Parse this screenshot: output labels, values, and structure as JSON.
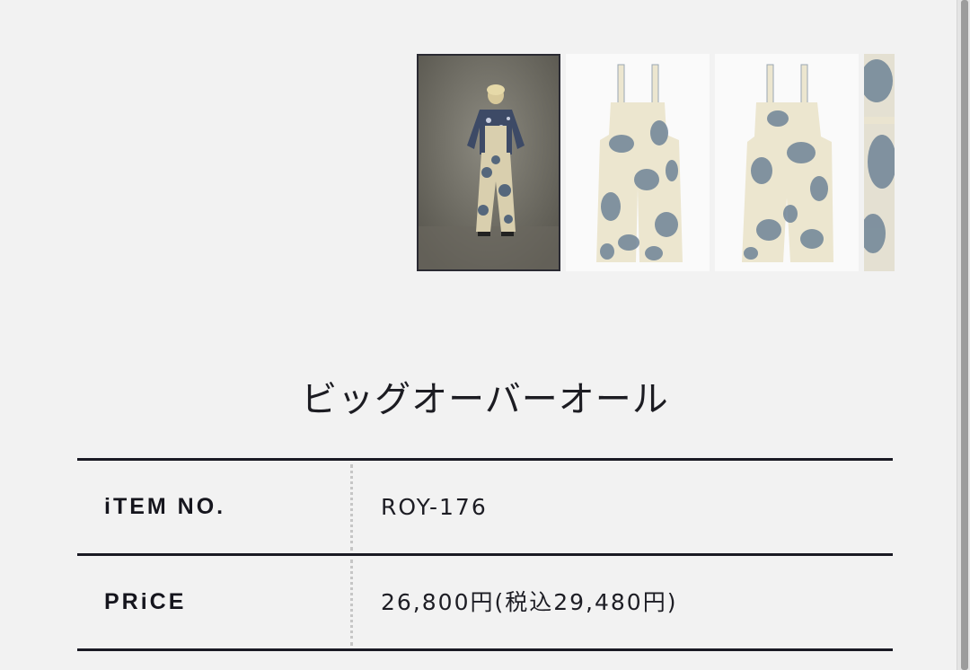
{
  "gallery": {
    "thumbnails": [
      {
        "kind": "model-photo",
        "selected": true
      },
      {
        "kind": "front-view",
        "selected": false
      },
      {
        "kind": "back-view",
        "selected": false
      },
      {
        "kind": "detail-view",
        "selected": false
      }
    ]
  },
  "product": {
    "title": "ビッグオーバーオール"
  },
  "specs": {
    "item_no_label": "iTEM NO.",
    "item_no_value": "ROY-176",
    "price_label": "PRiCE",
    "price_value": "26,800円(税込29,480円)"
  },
  "colors": {
    "background": "#f2f2f2",
    "rule": "#1a1a24",
    "fabric_cream": "#ece6cf",
    "tie_dye_blue": "#6f8497"
  }
}
